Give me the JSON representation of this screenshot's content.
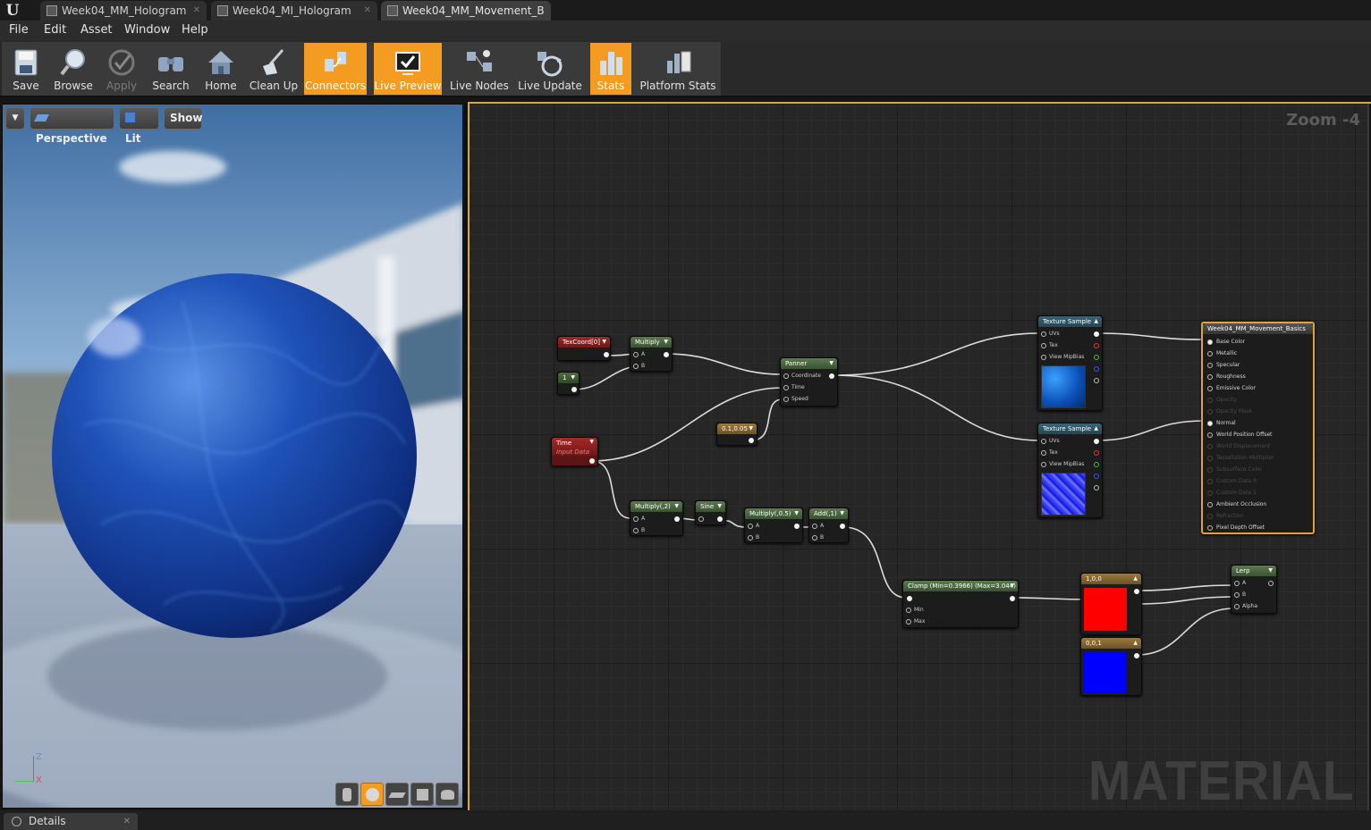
{
  "app": {
    "logo": "U"
  },
  "tabs": [
    {
      "label": "Week04_MM_Hologram",
      "icon": "material-asset-icon",
      "active": false
    },
    {
      "label": "Week04_MI_Hologram",
      "icon": "material-instance-icon",
      "active": false
    },
    {
      "label": "Week04_MM_Movement_B",
      "icon": "material-asset-icon",
      "active": true
    }
  ],
  "menu": [
    "File",
    "Edit",
    "Asset",
    "Window",
    "Help"
  ],
  "toolbar": [
    {
      "label": "Save",
      "icon": "save-icon",
      "state": "normal"
    },
    {
      "label": "Browse",
      "icon": "browse-icon",
      "state": "normal"
    },
    {
      "label": "Apply",
      "icon": "apply-icon",
      "state": "disabled"
    },
    {
      "label": "Search",
      "icon": "search-icon",
      "state": "normal"
    },
    {
      "label": "Home",
      "icon": "home-icon",
      "state": "normal"
    },
    {
      "label": "Clean Up",
      "icon": "clean-up-icon",
      "state": "normal"
    },
    {
      "label": "Connectors",
      "icon": "connectors-icon",
      "state": "active"
    },
    {
      "label": "Live Preview",
      "icon": "live-preview-icon",
      "state": "active"
    },
    {
      "label": "Live Nodes",
      "icon": "live-nodes-icon",
      "state": "normal"
    },
    {
      "label": "Live Update",
      "icon": "live-update-icon",
      "state": "normal"
    },
    {
      "label": "Stats",
      "icon": "stats-icon",
      "state": "active"
    },
    {
      "label": "Platform Stats",
      "icon": "platform-stats-icon",
      "state": "normal"
    }
  ],
  "viewport": {
    "perspective": "Perspective",
    "lit": "Lit",
    "show": "Show",
    "axis_z": "Z",
    "axis_x": "X",
    "preview_shapes": [
      "cylinder-icon",
      "sphere-icon",
      "plane-icon",
      "cube-icon",
      "custom-mesh-icon"
    ],
    "active_shape": "sphere-icon"
  },
  "graph": {
    "zoom": "Zoom -4",
    "watermark": "MATERIAL",
    "nodes": {
      "texcoord": {
        "title": "TexCoord[0]"
      },
      "multiply1": {
        "title": "Multiply",
        "pins": [
          "A",
          "B"
        ]
      },
      "const1": {
        "title": "1"
      },
      "panner": {
        "title": "Panner",
        "pins": [
          "Coordinate",
          "Time",
          "Speed"
        ]
      },
      "speed": {
        "title": "0.1,0.05"
      },
      "time": {
        "title": "Time",
        "subtitle": "Input Data"
      },
      "multiply2": {
        "title": "Multiply(,2)",
        "pins": [
          "A",
          "B"
        ]
      },
      "sine": {
        "title": "Sine"
      },
      "multiply3": {
        "title": "Multiply(,0.5)",
        "pins": [
          "A",
          "B"
        ]
      },
      "add": {
        "title": "Add(,1)",
        "pins": [
          "A",
          "B"
        ]
      },
      "tex1": {
        "title": "Texture Sample",
        "pins": [
          "UVs",
          "Tex",
          "View MipBias"
        ]
      },
      "tex2": {
        "title": "Texture Sample",
        "pins": [
          "UVs",
          "Tex",
          "View MipBias"
        ]
      },
      "clamp": {
        "title": "Clamp (Min=0.3966) (Max=3.044)",
        "pins": [
          "Min",
          "Max"
        ]
      },
      "red": {
        "title": "1,0,0",
        "color": "#ff0000"
      },
      "blue": {
        "title": "0,0,1",
        "color": "#0000ff"
      },
      "lerp": {
        "title": "Lerp",
        "pins": [
          "A",
          "B",
          "Alpha"
        ]
      },
      "result": {
        "title": "Week04_MM_Movement_Basics",
        "pins": [
          {
            "label": "Base Color",
            "enabled": true
          },
          {
            "label": "Metallic",
            "enabled": true
          },
          {
            "label": "Specular",
            "enabled": true
          },
          {
            "label": "Roughness",
            "enabled": true
          },
          {
            "label": "Emissive Color",
            "enabled": true
          },
          {
            "label": "Opacity",
            "enabled": false
          },
          {
            "label": "Opacity Mask",
            "enabled": false
          },
          {
            "label": "Normal",
            "enabled": true
          },
          {
            "label": "World Position Offset",
            "enabled": true
          },
          {
            "label": "World Displacement",
            "enabled": false
          },
          {
            "label": "Tessellation Multiplier",
            "enabled": false
          },
          {
            "label": "Subsurface Color",
            "enabled": false
          },
          {
            "label": "Custom Data 0",
            "enabled": false
          },
          {
            "label": "Custom Data 1",
            "enabled": false
          },
          {
            "label": "Ambient Occlusion",
            "enabled": true
          },
          {
            "label": "Refraction",
            "enabled": false
          },
          {
            "label": "Pixel Depth Offset",
            "enabled": true
          }
        ]
      }
    }
  },
  "details": {
    "tab_label": "Details"
  },
  "colors": {
    "accent": "#f39c21",
    "graph_bg": "#262626",
    "result_border": "#e3a13a"
  }
}
